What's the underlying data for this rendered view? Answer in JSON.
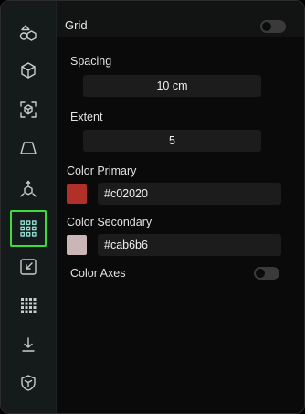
{
  "sidebar": {
    "items": [
      {
        "icon": "shapes-icon"
      },
      {
        "icon": "cube-icon"
      },
      {
        "icon": "focus-cube-icon"
      },
      {
        "icon": "perspective-icon"
      },
      {
        "icon": "axes-icon"
      },
      {
        "icon": "grid-icon",
        "active": true
      },
      {
        "icon": "shrink-icon"
      },
      {
        "icon": "dots-grid-icon"
      },
      {
        "icon": "download-icon"
      },
      {
        "icon": "shield-cube-icon"
      }
    ]
  },
  "panel": {
    "title": "Grid",
    "grid_enabled": false,
    "spacing": {
      "label": "Spacing",
      "value": "10 cm"
    },
    "extent": {
      "label": "Extent",
      "value": "5"
    },
    "color_primary": {
      "label": "Color Primary",
      "value": "#c02020",
      "swatch": "#b2302a"
    },
    "color_secondary": {
      "label": "Color Secondary",
      "value": "#cab6b6",
      "swatch": "#cab6b6"
    },
    "color_axes": {
      "label": "Color Axes",
      "enabled": false
    }
  },
  "colors": {
    "accent_active": "#3ddc3d"
  }
}
